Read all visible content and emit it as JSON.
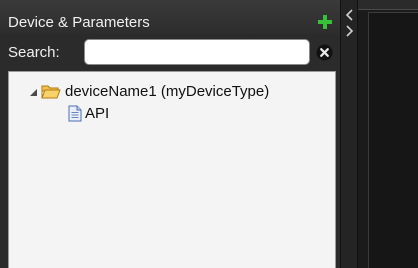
{
  "panel": {
    "title": "Device & Parameters",
    "add_icon": "plus-icon",
    "add_icon_color": "#38c23a"
  },
  "search": {
    "label": "Search:",
    "value": "",
    "placeholder": "",
    "clear_icon": "clear-circle-x-icon"
  },
  "tree": {
    "device": {
      "label": "deviceName1 (myDeviceType)",
      "expand_icon": "expanded-triangle-icon",
      "folder_icon": "open-folder-icon",
      "folder_color": "#f0b73a"
    },
    "child": {
      "label": "API",
      "icon": "document-icon"
    }
  },
  "splitter": {
    "collapse_icon": "double-chevron-icon"
  }
}
